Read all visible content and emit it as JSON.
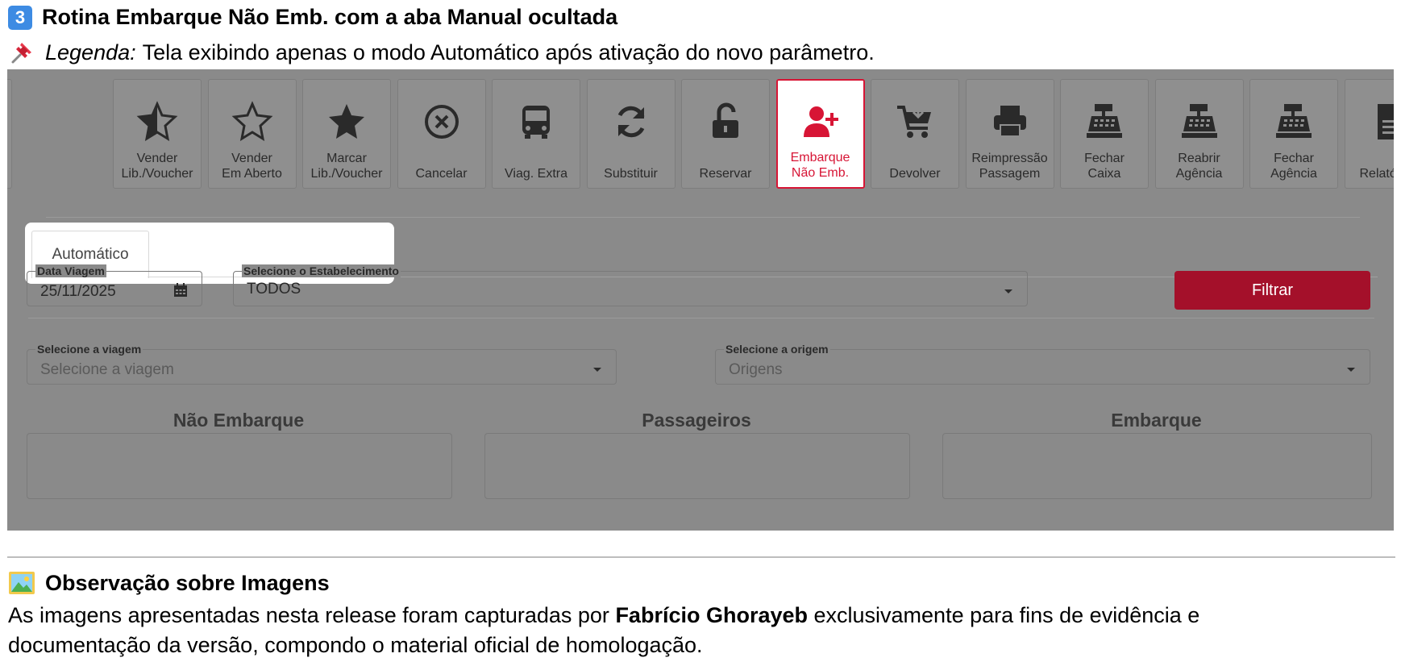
{
  "document": {
    "heading_number": "3",
    "heading": "Rotina Embarque Não Emb. com a aba Manual ocultada",
    "legend_label": "Legenda:",
    "legend_text": "Tela exibindo apenas o modo Automático após ativação do novo parâmetro.",
    "obs_title": "Observação sobre Imagens",
    "para_line1_a": "As imagens apresentadas nesta release foram capturadas por ",
    "para_author": "Fabrício Ghorayeb",
    "para_line1_b": " exclusivamente para fins de evidência e",
    "para_line2": "documentação da versão, compondo o material oficial de homologação."
  },
  "toolbar": {
    "items": [
      {
        "label1": "Vender",
        "label2": "Lib./Voucher",
        "icon": "star-half-icon"
      },
      {
        "label1": "Vender",
        "label2": "Em Aberto",
        "icon": "star-outline-icon"
      },
      {
        "label1": "Marcar",
        "label2": "Lib./Voucher",
        "icon": "star-solid-icon"
      },
      {
        "label1": "Cancelar",
        "label2": "",
        "icon": "cancel-circle-icon"
      },
      {
        "label1": "Viag. Extra",
        "label2": "",
        "icon": "bus-icon"
      },
      {
        "label1": "Substituir",
        "label2": "",
        "icon": "sync-icon"
      },
      {
        "label1": "Reservar",
        "label2": "",
        "icon": "unlock-icon"
      },
      {
        "label1": "Embarque",
        "label2": "Não Emb.",
        "icon": "user-plus-icon"
      },
      {
        "label1": "Devolver",
        "label2": "",
        "icon": "cart-return-icon"
      },
      {
        "label1": "Reimpressão",
        "label2": "Passagem",
        "icon": "printer-icon"
      },
      {
        "label1": "Fechar",
        "label2": "Caixa",
        "icon": "cash-register-icon"
      },
      {
        "label1": "Reabrir",
        "label2": "Agência",
        "icon": "cash-register-icon"
      },
      {
        "label1": "Fechar",
        "label2": "Agência",
        "icon": "cash-register-icon"
      },
      {
        "label1": "Relatórios",
        "label2": "",
        "icon": "file-icon"
      }
    ],
    "active_index": 7
  },
  "tabs": {
    "automatic": "Automático"
  },
  "form": {
    "date_label": "Data Viagem",
    "date_value": "25/11/2025",
    "establishment_label": "Selecione o Estabelecimento",
    "establishment_value": "TODOS",
    "filter_button": "Filtrar",
    "trip_label": "Selecione a viagem",
    "trip_placeholder": "Selecione a viagem",
    "origin_label": "Selecione a origem",
    "origin_placeholder": "Origens"
  },
  "columns": {
    "left": "Não Embarque",
    "center": "Passageiros",
    "right": "Embarque"
  },
  "colors": {
    "accent": "#d71535",
    "filter_button": "#a4102a",
    "overlay_gray": "#8a8a8a"
  }
}
